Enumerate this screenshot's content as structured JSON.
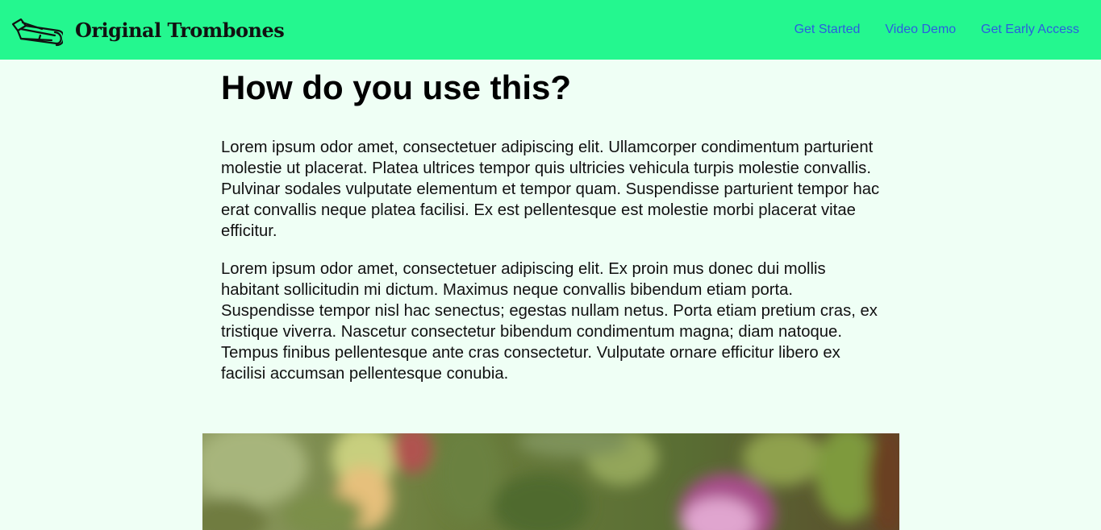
{
  "header": {
    "brand_name": "Original Trombones",
    "brand_icon": "trombone-icon",
    "nav": [
      {
        "label": "Get Started"
      },
      {
        "label": "Video Demo"
      },
      {
        "label": "Get Early Access"
      }
    ]
  },
  "main": {
    "heading": "How do you use this?",
    "paragraphs": [
      "Lorem ipsum odor amet, consectetuer adipiscing elit. Ullamcorper condimentum parturient molestie ut placerat. Platea ultrices tempor quis ultricies vehicula turpis molestie convallis. Pulvinar sodales vulputate elementum et tempor quam. Suspendisse parturient tempor hac erat convallis neque platea facilisi. Ex est pellentesque est molestie morbi placerat vitae efficitur.",
      "Lorem ipsum odor amet, consectetuer adipiscing elit. Ex proin mus donec dui mollis habitant sollicitudin mi dictum. Maximus neque convallis bibendum etiam porta. Suspendisse tempor nisl hac senectus; egestas nullam netus. Porta etiam pretium cras, ex tristique viverra. Nascetur consectetur bibendum condimentum magna; diam natoque. Tempus finibus pellentesque ante cras consectetur. Vulputate ornare efficitur libero ex facilisi accumsan pellentesque conubia."
    ]
  },
  "colors": {
    "header_bg": "#24f78f",
    "page_bg": "#effff5",
    "nav_link": "#2b5de0"
  }
}
